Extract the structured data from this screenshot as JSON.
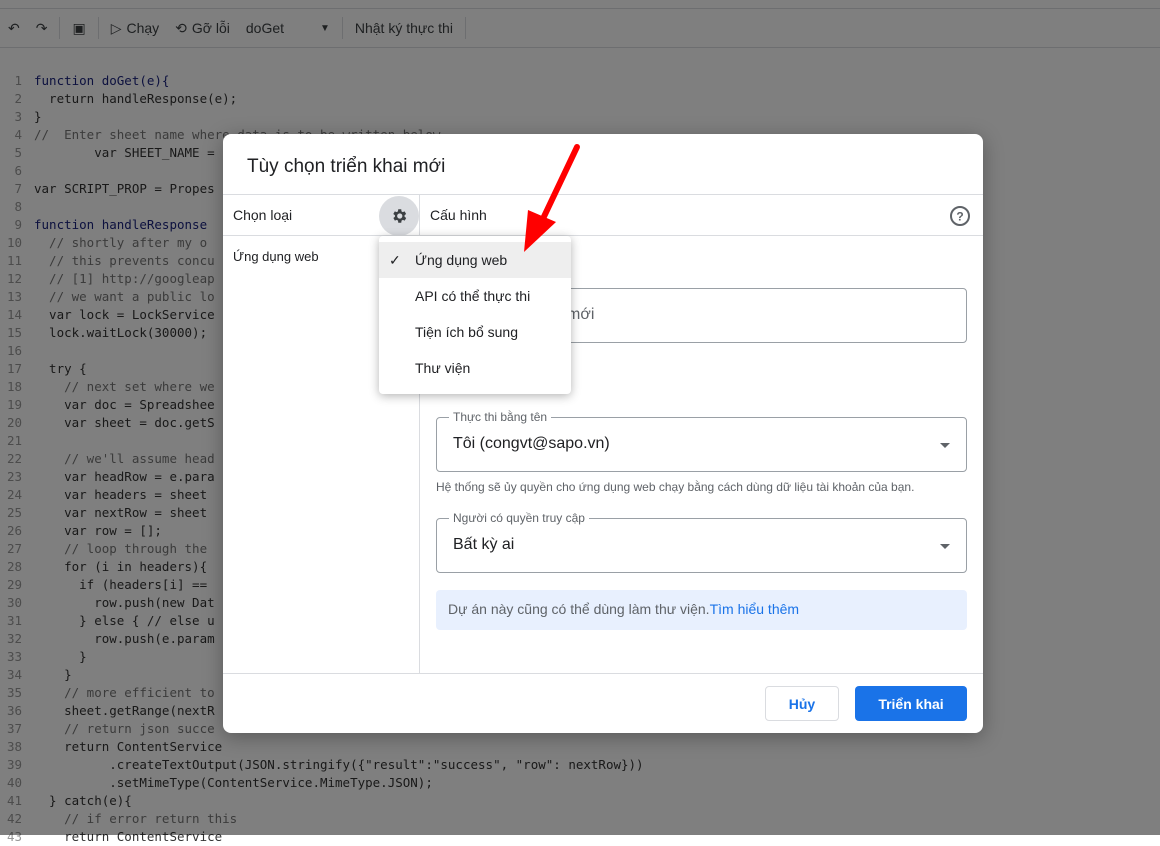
{
  "toolbar": {
    "run": "Chạy",
    "debug": "Gỡ lỗi",
    "function": "doGet",
    "log": "Nhật ký thực thi"
  },
  "code": [
    {
      "n": "1",
      "t": "function doGet(e){",
      "c": "kw"
    },
    {
      "n": "2",
      "t": "  return handleResponse(e);",
      "c": ""
    },
    {
      "n": "3",
      "t": "}",
      "c": ""
    },
    {
      "n": "4",
      "t": "//  Enter sheet name where data is to be written below",
      "c": "cm"
    },
    {
      "n": "5",
      "t": "        var SHEET_NAME = ",
      "c": ""
    },
    {
      "n": "6",
      "t": "",
      "c": ""
    },
    {
      "n": "7",
      "t": "var SCRIPT_PROP = Propes",
      "c": ""
    },
    {
      "n": "8",
      "t": "",
      "c": ""
    },
    {
      "n": "9",
      "t": "function handleResponse",
      "c": "kw"
    },
    {
      "n": "10",
      "t": "  // shortly after my o",
      "c": "cm"
    },
    {
      "n": "11",
      "t": "  // this prevents concu",
      "c": "cm"
    },
    {
      "n": "12",
      "t": "  // [1] http://googleap",
      "c": "cm"
    },
    {
      "n": "13",
      "t": "  // we want a public lo",
      "c": "cm"
    },
    {
      "n": "14",
      "t": "  var lock = LockService",
      "c": ""
    },
    {
      "n": "15",
      "t": "  lock.waitLock(30000);",
      "c": ""
    },
    {
      "n": "16",
      "t": "",
      "c": ""
    },
    {
      "n": "17",
      "t": "  try {",
      "c": ""
    },
    {
      "n": "18",
      "t": "    // next set where we",
      "c": "cm"
    },
    {
      "n": "19",
      "t": "    var doc = Spreadshee",
      "c": ""
    },
    {
      "n": "20",
      "t": "    var sheet = doc.getS",
      "c": ""
    },
    {
      "n": "21",
      "t": "",
      "c": ""
    },
    {
      "n": "22",
      "t": "    // we'll assume head",
      "c": "cm"
    },
    {
      "n": "23",
      "t": "    var headRow = e.para",
      "c": ""
    },
    {
      "n": "24",
      "t": "    var headers = sheet",
      "c": ""
    },
    {
      "n": "25",
      "t": "    var nextRow = sheet",
      "c": ""
    },
    {
      "n": "26",
      "t": "    var row = [];",
      "c": ""
    },
    {
      "n": "27",
      "t": "    // loop through the",
      "c": "cm"
    },
    {
      "n": "28",
      "t": "    for (i in headers){",
      "c": ""
    },
    {
      "n": "29",
      "t": "      if (headers[i] ==",
      "c": ""
    },
    {
      "n": "30",
      "t": "        row.push(new Dat",
      "c": ""
    },
    {
      "n": "31",
      "t": "      } else { // else u",
      "c": ""
    },
    {
      "n": "32",
      "t": "        row.push(e.param",
      "c": ""
    },
    {
      "n": "33",
      "t": "      }",
      "c": ""
    },
    {
      "n": "34",
      "t": "    }",
      "c": ""
    },
    {
      "n": "35",
      "t": "    // more efficient to",
      "c": "cm"
    },
    {
      "n": "36",
      "t": "    sheet.getRange(nextR",
      "c": ""
    },
    {
      "n": "37",
      "t": "    // return json succe",
      "c": "cm"
    },
    {
      "n": "38",
      "t": "    return ContentService",
      "c": ""
    },
    {
      "n": "39",
      "t": "          .createTextOutput(JSON.stringify({\"result\":\"success\", \"row\": nextRow}))",
      "c": ""
    },
    {
      "n": "40",
      "t": "          .setMimeType(ContentService.MimeType.JSON);",
      "c": ""
    },
    {
      "n": "41",
      "t": "  } catch(e){",
      "c": ""
    },
    {
      "n": "42",
      "t": "    // if error return this",
      "c": "cm"
    },
    {
      "n": "43",
      "t": "    return ContentService",
      "c": ""
    }
  ],
  "dialog": {
    "title": "Tùy chọn triển khai mới",
    "select_type": "Chọn loại",
    "config": "Cấu hình",
    "left_item": "Ứng dụng web",
    "description_partial": "mới",
    "execute_as_label": "Thực thi bằng tên",
    "execute_as_value": "Tôi (congvt@sapo.vn)",
    "helper": "Hệ thống sẽ ủy quyền cho ứng dụng web chạy bằng cách dùng dữ liệu tài khoản của bạn.",
    "access_label": "Người có quyền truy cập",
    "access_value": "Bất kỳ ai",
    "info": "Dự án này cũng có thể dùng làm thư viện.",
    "info_link": "Tìm hiểu thêm",
    "cancel": "Hủy",
    "deploy": "Triển khai"
  },
  "menu": {
    "items": [
      "Ứng dụng web",
      "API có thể thực thi",
      "Tiện ích bổ sung",
      "Thư viện"
    ],
    "selected": 0
  },
  "colors": {
    "accent": "#1a73e8",
    "arrow": "#ff0000"
  }
}
